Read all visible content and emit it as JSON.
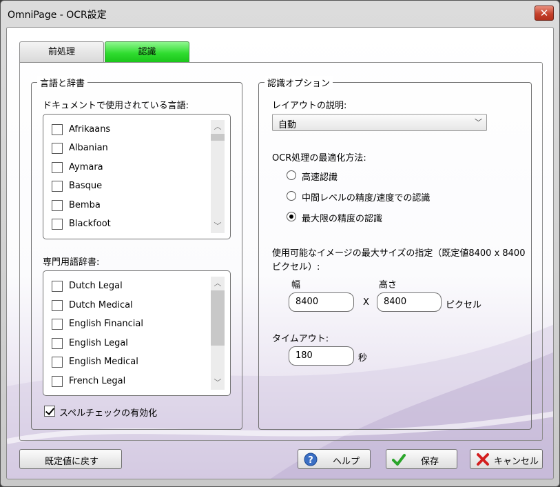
{
  "window": {
    "title": "OmniPage - OCR設定",
    "close_glyph": "✕"
  },
  "tabs": [
    {
      "label": "前処理"
    },
    {
      "label": "認識"
    }
  ],
  "language_group": {
    "legend": "言語と辞書",
    "languages_label": "ドキュメントで使用されている言語:",
    "languages": [
      {
        "label": "Afrikaans",
        "checked": false
      },
      {
        "label": "Albanian",
        "checked": false
      },
      {
        "label": "Aymara",
        "checked": false
      },
      {
        "label": "Basque",
        "checked": false
      },
      {
        "label": "Bemba",
        "checked": false
      },
      {
        "label": "Blackfoot",
        "checked": false
      }
    ],
    "dictionary_label": "専門用語辞書:",
    "dictionaries": [
      {
        "label": "Dutch Legal",
        "checked": false
      },
      {
        "label": "Dutch Medical",
        "checked": false
      },
      {
        "label": "English Financial",
        "checked": false
      },
      {
        "label": "English Legal",
        "checked": false
      },
      {
        "label": "English Medical",
        "checked": false
      },
      {
        "label": "French Legal",
        "checked": false
      }
    ],
    "spellcheck": {
      "label": "スペルチェックの有効化",
      "checked": true
    }
  },
  "options_group": {
    "legend": "認識オプション",
    "layout_label": "レイアウトの説明:",
    "layout_value": "自動",
    "optimize_label": "OCR処理の最適化方法:",
    "optimize_options": [
      {
        "label": "高速認識",
        "selected": false
      },
      {
        "label": "中間レベルの精度/速度での認識",
        "selected": false
      },
      {
        "label": "最大限の精度の認識",
        "selected": true
      }
    ],
    "max_size_label_line1": "使用可能なイメージの最大サイズの指定（既定値8400 x 8400",
    "max_size_label_line2": "ピクセル）:",
    "width_label": "幅",
    "height_label": "高さ",
    "width_value": "8400",
    "height_value": "8400",
    "times_symbol": "X",
    "pixel_unit": "ピクセル",
    "timeout_label": "タイムアウト:",
    "timeout_value": "180",
    "timeout_unit": "秒"
  },
  "buttons": {
    "reset": "既定値に戻す",
    "help": "ヘルプ",
    "save": "保存",
    "cancel": "キャンセル"
  },
  "icons": {
    "help": "question-circle-icon",
    "save": "green-check-icon",
    "cancel": "red-x-icon"
  },
  "colors": {
    "active_tab": "#2fdc2f",
    "close_button": "#c5412b",
    "help_icon": "#3b6fc4",
    "save_icon": "#2aa52a",
    "cancel_icon": "#d31f1f"
  }
}
